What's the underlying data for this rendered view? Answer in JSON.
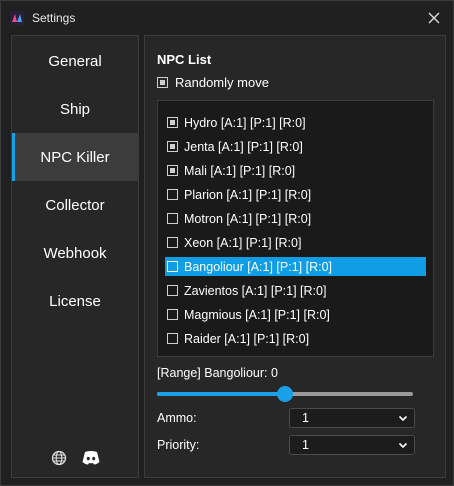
{
  "window": {
    "title": "Settings"
  },
  "sidebar": {
    "items": [
      {
        "label": "General",
        "active": false
      },
      {
        "label": "Ship",
        "active": false
      },
      {
        "label": "NPC Killer",
        "active": true
      },
      {
        "label": "Collector",
        "active": false
      },
      {
        "label": "Webhook",
        "active": false
      },
      {
        "label": "License",
        "active": false
      }
    ],
    "footer_icons": [
      "globe-icon",
      "discord-icon"
    ]
  },
  "npc": {
    "title": "NPC List",
    "randomly_move": {
      "label": "Randomly move",
      "checked": true
    },
    "list": [
      {
        "label": "Hydro [A:1] [P:1] [R:0]",
        "checked": true,
        "selected": false
      },
      {
        "label": "Jenta [A:1] [P:1] [R:0]",
        "checked": true,
        "selected": false
      },
      {
        "label": "Mali [A:1] [P:1] [R:0]",
        "checked": true,
        "selected": false
      },
      {
        "label": "Plarion [A:1] [P:1] [R:0]",
        "checked": false,
        "selected": false
      },
      {
        "label": "Motron [A:1] [P:1] [R:0]",
        "checked": false,
        "selected": false
      },
      {
        "label": "Xeon [A:1] [P:1] [R:0]",
        "checked": false,
        "selected": false
      },
      {
        "label": "Bangoliour [A:1] [P:1] [R:0]",
        "checked": false,
        "selected": true
      },
      {
        "label": "Zavientos [A:1] [P:1] [R:0]",
        "checked": false,
        "selected": false
      },
      {
        "label": "Magmious [A:1] [P:1] [R:0]",
        "checked": false,
        "selected": false
      },
      {
        "label": "Raider [A:1] [P:1] [R:0]",
        "checked": false,
        "selected": false
      }
    ],
    "range": {
      "label": "[Range] Bangoliour: 0",
      "value_fraction": 0.5
    },
    "ammo": {
      "label": "Ammo:",
      "value": "1"
    },
    "priority": {
      "label": "Priority:",
      "value": "1"
    }
  },
  "colors": {
    "accent": "#1aa0e6",
    "background": "#202020",
    "panel": "#272727"
  }
}
